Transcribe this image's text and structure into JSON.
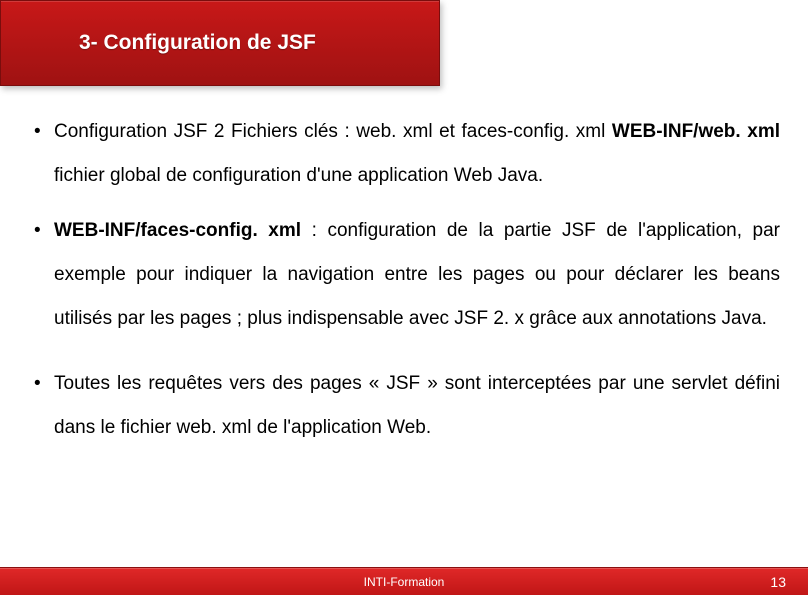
{
  "header": {
    "title": "3- Configuration de JSF"
  },
  "bullets": [
    {
      "intro": "Configuration JSF 2 Fichiers clés : web. xml et faces-config. xml ",
      "bold1": "WEB-INF/web. xml",
      "rest1": " fichier global de configuration d'une application Web Java."
    },
    {
      "bold2": "WEB-INF/faces-config. xml",
      "rest2": " : configuration de la partie JSF de l'application, par exemple pour indiquer la navigation entre les pages ou pour déclarer les beans utilisés par les pages ; plus indispensable avec JSF 2. x grâce aux annotations Java."
    },
    {
      "text3": "Toutes les requêtes vers des pages « JSF » sont interceptées par une servlet défini dans le fichier web. xml de l'application Web."
    }
  ],
  "footer": {
    "center": "INTI-Formation",
    "page": "13"
  }
}
